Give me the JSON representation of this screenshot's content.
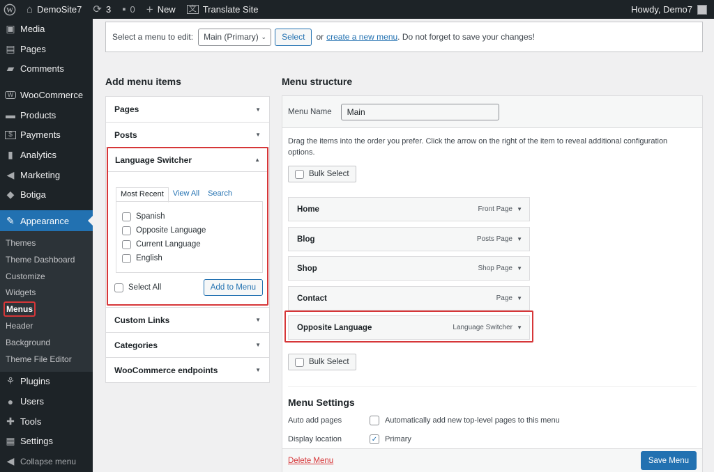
{
  "adminbar": {
    "site": "DemoSite7",
    "updates": "3",
    "comments": "0",
    "new": "New",
    "translate": "Translate Site",
    "howdy": "Howdy, Demo7"
  },
  "sidebar": {
    "items_top": [
      "Media",
      "Pages",
      "Comments",
      "WooCommerce",
      "Products",
      "Payments",
      "Analytics",
      "Marketing",
      "Botiga"
    ],
    "current": "Appearance",
    "submenu": [
      "Themes",
      "Theme Dashboard",
      "Customize",
      "Widgets",
      "Menus",
      "Header",
      "Background",
      "Theme File Editor"
    ],
    "items_bottom": [
      "Plugins",
      "Users",
      "Tools",
      "Settings"
    ],
    "collapse": "Collapse menu"
  },
  "select_bar": {
    "label": "Select a menu to edit:",
    "selected": "Main (Primary)",
    "select_button": "Select",
    "or": "or",
    "create_link": "create a new menu",
    "tail": ". Do not forget to save your changes!"
  },
  "add_items": {
    "title": "Add menu items",
    "sections": [
      "Pages",
      "Posts",
      "Language Switcher",
      "Custom Links",
      "Categories",
      "WooCommerce endpoints"
    ],
    "tabs": [
      "Most Recent",
      "View All",
      "Search"
    ],
    "options": [
      "Spanish",
      "Opposite Language",
      "Current Language",
      "English"
    ],
    "select_all": "Select All",
    "add_button": "Add to Menu"
  },
  "structure": {
    "title": "Menu structure",
    "name_label": "Menu Name",
    "name_value": "Main",
    "hint": "Drag the items into the order you prefer. Click the arrow on the right of the item to reveal additional configuration options.",
    "bulk_select": "Bulk Select",
    "items": [
      {
        "title": "Home",
        "type": "Front Page"
      },
      {
        "title": "Blog",
        "type": "Posts Page"
      },
      {
        "title": "Shop",
        "type": "Shop Page"
      },
      {
        "title": "Contact",
        "type": "Page"
      },
      {
        "title": "Opposite Language",
        "type": "Language Switcher"
      }
    ],
    "settings_title": "Menu Settings",
    "auto_add_label": "Auto add pages",
    "auto_add_text": "Automatically add new top-level pages to this menu",
    "display_label": "Display location",
    "display_text": "Primary",
    "delete": "Delete Menu",
    "save": "Save Menu"
  }
}
